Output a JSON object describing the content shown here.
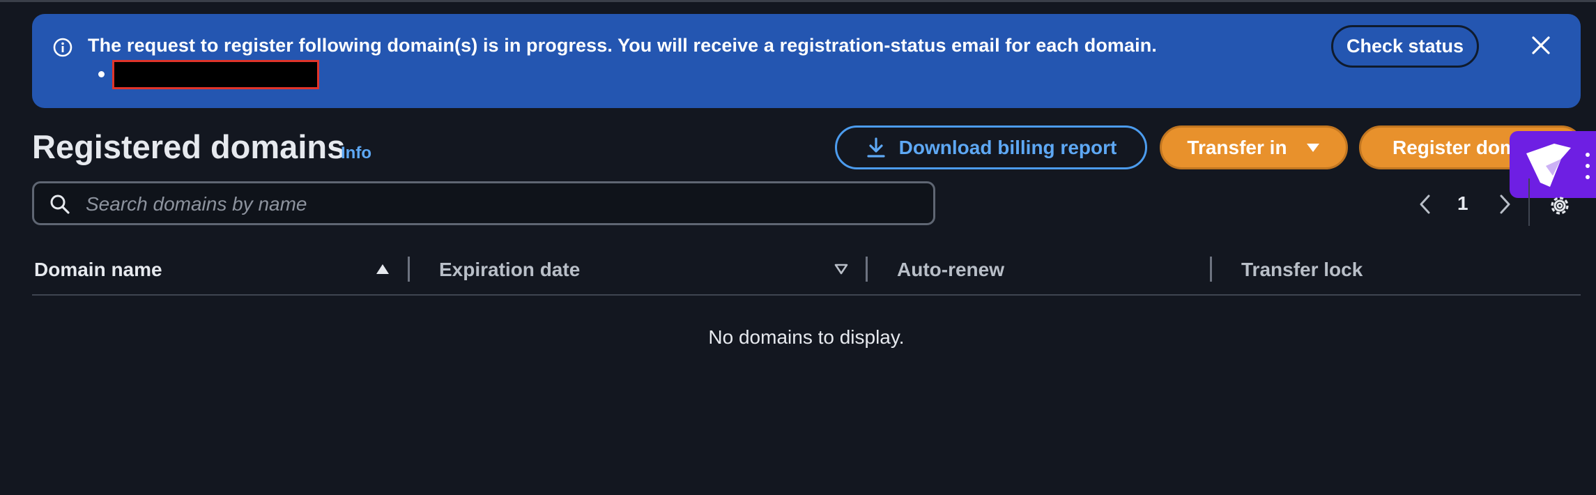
{
  "flashbar": {
    "message": "The request to register following domain(s) is in progress. You will receive a registration-status email for each domain.",
    "check_status_label": "Check status",
    "background": "#2456b1"
  },
  "header": {
    "title": "Registered domains",
    "info_label": "Info",
    "download_label": "Download billing report",
    "transfer_label": "Transfer in",
    "register_label": "Register domains"
  },
  "search": {
    "placeholder": "Search domains by name",
    "value": ""
  },
  "pagination": {
    "current_page": "1"
  },
  "table": {
    "columns": [
      "Domain name",
      "Expiration date",
      "Auto-renew",
      "Transfer lock"
    ],
    "empty_message": "No domains to display."
  },
  "colors": {
    "accent_orange": "#e8912c",
    "link_blue": "#5ea8f4",
    "widget_purple": "#6e1fe3"
  }
}
